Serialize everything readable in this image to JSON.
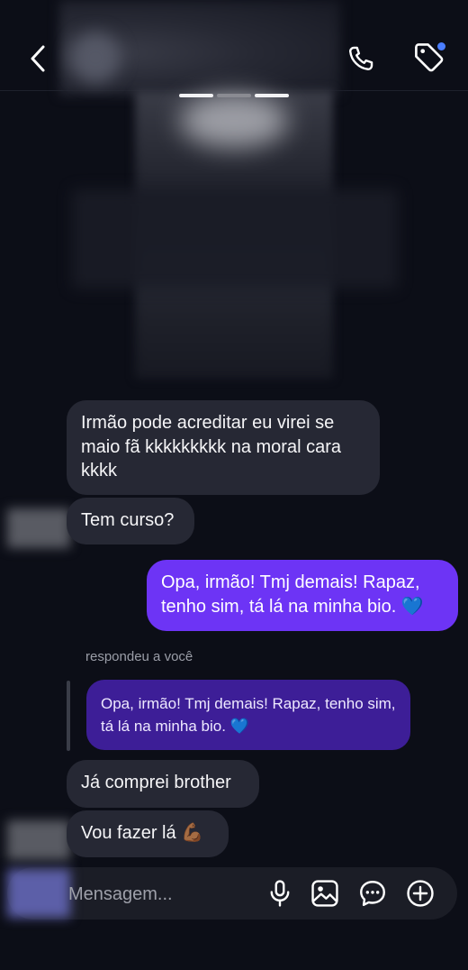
{
  "header": {
    "back_icon": "chevron-left-icon",
    "call_icon": "phone-icon",
    "tag_icon": "tag-icon"
  },
  "messages": [
    {
      "side": "incoming",
      "text": "Irmão pode acreditar eu virei se maio fã kkkkkkkkk na moral cara kkkk"
    },
    {
      "side": "incoming",
      "text": "Tem curso?"
    },
    {
      "side": "outgoing",
      "text": "Opa, irmão! Tmj demais! Rapaz, tenho sim, tá lá na minha bio. 💙"
    },
    {
      "side": "incoming",
      "text": "Já comprei brother"
    },
    {
      "side": "incoming",
      "text": "Vou fazer lá 💪🏾"
    }
  ],
  "reply": {
    "label": "respondeu a você",
    "quoted_text": "Opa, irmão! Tmj demais! Rapaz, tenho sim, tá lá na minha bio. 💙"
  },
  "composer": {
    "placeholder": "Mensagem...",
    "icons": [
      "microphone-icon",
      "image-icon",
      "sticker-icon",
      "plus-circle-icon"
    ]
  },
  "colors": {
    "background": "#0c0e17",
    "incoming_bubble": "#262834",
    "outgoing_bubble": "#6d34f5",
    "quoted_bubble": "#3d1e97",
    "notification_dot": "#4a7dff"
  }
}
